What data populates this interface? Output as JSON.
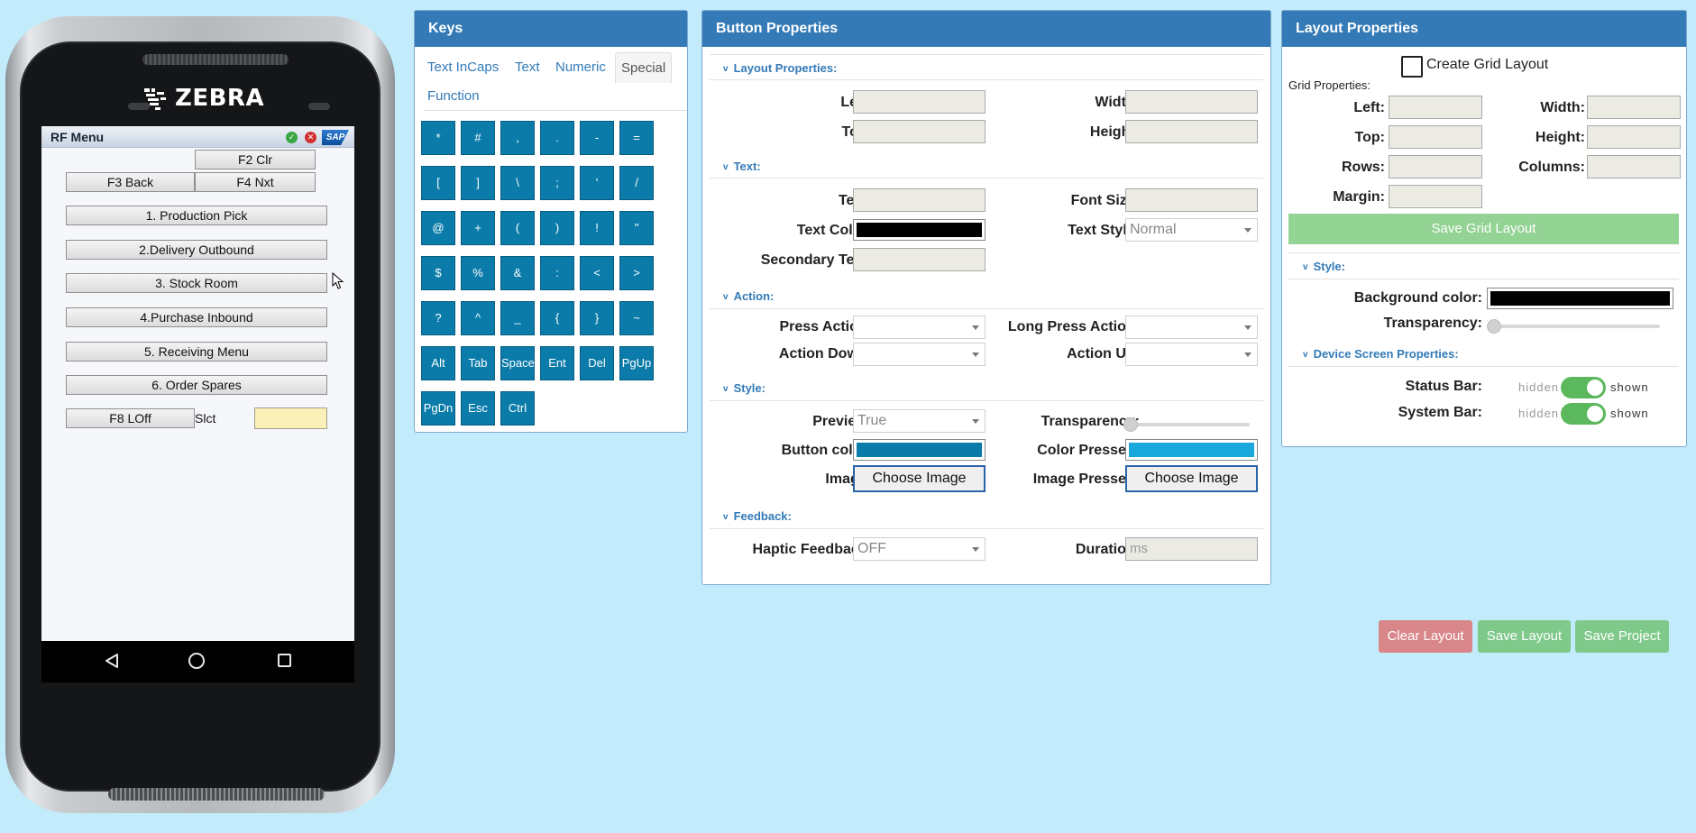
{
  "device": {
    "brand": "ZEBRA",
    "screen": {
      "title": "RF Menu",
      "sap_label": "SAP",
      "buttons": {
        "f2": "F2 Clr",
        "f3": "F3 Back",
        "f4": "F4 Nxt",
        "menu1": "1. Production Pick",
        "menu2": "2.Delivery Outbound",
        "menu3": "3. Stock Room",
        "menu4": "4.Purchase Inbound",
        "menu5": "5. Receiving Menu",
        "menu6": "6. Order Spares",
        "f8": "F8 LOff"
      },
      "select_label": "Slct",
      "select_value": ""
    }
  },
  "keys_panel": {
    "title": "Keys",
    "tabs": [
      "Text InCaps",
      "Text",
      "Numeric",
      "Special",
      "Function"
    ],
    "active_tab": "Special",
    "keys": [
      "*",
      "#",
      ",",
      ".",
      "-",
      "=",
      "[",
      "]",
      "\\",
      ";",
      "'",
      "/",
      "@",
      "+",
      "(",
      ")",
      "!",
      "\"",
      "$",
      "%",
      "&",
      ":",
      "<",
      ">",
      "?",
      "^",
      "_",
      "{",
      "}",
      "~",
      "Alt",
      "Tab",
      "Space",
      "Ent",
      "Del",
      "PgUp",
      "PgDn",
      "Esc",
      "Ctrl"
    ]
  },
  "button_properties": {
    "title": "Button Properties",
    "sections": {
      "layout": "Layout Properties:",
      "text": "Text:",
      "action": "Action:",
      "style": "Style:",
      "feedback": "Feedback:"
    },
    "labels": {
      "left": "Left:",
      "width": "Width:",
      "top": "Top:",
      "height": "Height:",
      "text": "Text:",
      "font_size": "Font Size:",
      "text_color": "Text Color:",
      "text_style": "Text Style:",
      "secondary_text": "Secondary Text:",
      "press_action": "Press Action:",
      "long_press_action": "Long Press Action:",
      "action_down": "Action Down:",
      "action_up": "Action Up:",
      "preview": "Preview:",
      "transparency": "Transparency:",
      "button_color": "Button color:",
      "color_pressed": "Color Pressed:",
      "image": "Image:",
      "image_pressed": "Image Pressed:",
      "haptic_feedback": "Haptic Feedback:",
      "duration": "Duration:"
    },
    "values": {
      "text_style": "Normal",
      "preview": "True",
      "haptic_feedback": "OFF",
      "duration_placeholder": "ms",
      "choose_image": "Choose Image",
      "choose_image_pressed": "Choose Image",
      "transparency": 0
    },
    "colors": {
      "text_color": "#000000",
      "button_color": "#0b7ba9",
      "color_pressed": "#1aa7dc"
    }
  },
  "layout_properties": {
    "title": "Layout Properties",
    "create_grid": "Create Grid Layout",
    "grid_properties": "Grid Properties:",
    "labels": {
      "left": "Left:",
      "width": "Width:",
      "top": "Top:",
      "height": "Height:",
      "rows": "Rows:",
      "columns": "Columns:",
      "margin": "Margin:",
      "background_color": "Background color:",
      "transparency": "Transparency:",
      "status_bar": "Status Bar:",
      "system_bar": "System Bar:"
    },
    "save_grid": "Save Grid Layout",
    "style_section": "Style:",
    "device_section": "Device Screen Properties:",
    "toggle_hidden": "hidden",
    "toggle_shown": "shown",
    "background_color": "#000000",
    "transparency": 0
  },
  "footer_buttons": {
    "clear": "Clear Layout",
    "save_layout": "Save Layout",
    "save_project": "Save Project"
  },
  "colors": {
    "page_bg": "#c2ecfb",
    "panel_header": "#337ab7",
    "key_bg": "#0b7ba9",
    "clear_btn": "#d9868a",
    "save_btn": "#7fc98a"
  }
}
